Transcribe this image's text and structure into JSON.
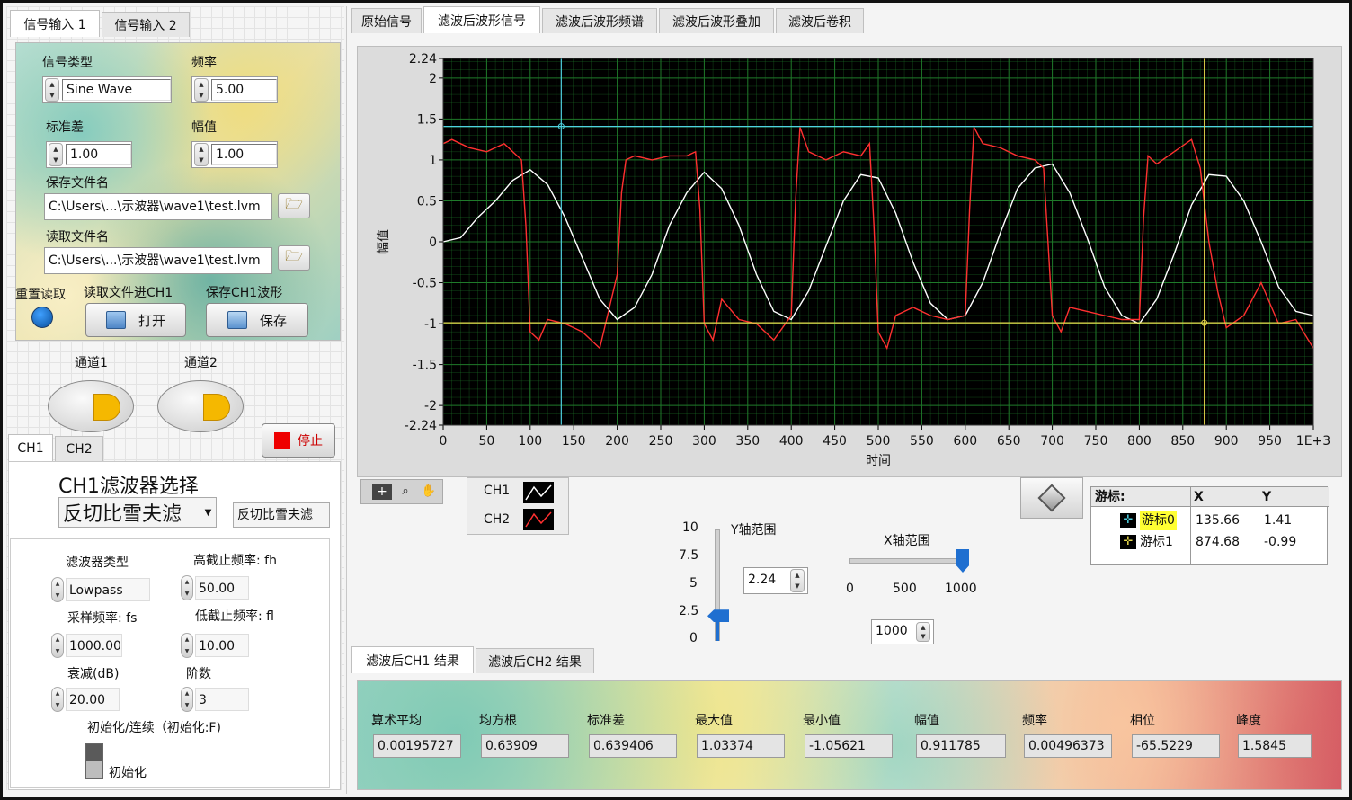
{
  "left_tabs": [
    "信号输入 1",
    "信号输入 2"
  ],
  "signal": {
    "type_label": "信号类型",
    "type_value": "Sine Wave",
    "freq_label": "频率",
    "freq_value": "5.00",
    "std_label": "标准差",
    "std_value": "1.00",
    "amp_label": "幅值",
    "amp_value": "1.00",
    "save_label": "保存文件名",
    "save_path": "C:\\Users\\...\\示波器\\wave1\\test.lvm",
    "read_label": "读取文件名",
    "read_path": "C:\\Users\\...\\示波器\\wave1\\test.lvm",
    "reset_label": "重置读取",
    "read_ch1_label": "读取文件进CH1",
    "open_label": "打开",
    "save_wave_label": "保存CH1波形",
    "save_btn_label": "保存"
  },
  "channels": {
    "ch1_label": "通道1",
    "ch2_label": "通道2",
    "stop_label": "停止"
  },
  "filter_tabs": [
    "CH1",
    "CH2"
  ],
  "filter": {
    "title": "CH1滤波器选择",
    "selected": "反切比雪夫滤",
    "selected_echo": "反切比雪夫滤",
    "type_label": "滤波器类型",
    "type_value": "Lowpass",
    "fh_label": "高截止频率: fh",
    "fh_value": "50.00",
    "fs_label": "采样频率: fs",
    "fs_value": "1000.00",
    "fl_label": "低截止频率: fl",
    "fl_value": "10.00",
    "atten_label": "衰减(dB)",
    "atten_value": "20.00",
    "order_label": "阶数",
    "order_value": "3",
    "init_label": "初始化/连续（初始化:F)",
    "init_switch_label": "初始化"
  },
  "graph_tabs": [
    "原始信号",
    "滤波后波形信号",
    "滤波后波形频谱",
    "滤波后波形叠加",
    "滤波后卷积"
  ],
  "graph_legend": [
    "CH1",
    "CH2"
  ],
  "cursor_table": {
    "headers": [
      "游标:",
      "X",
      "Y"
    ],
    "rows": [
      {
        "name": "游标0",
        "x": "135.66",
        "y": "1.41"
      },
      {
        "name": "游标1",
        "x": "874.68",
        "y": "-0.99"
      }
    ]
  },
  "y_range": {
    "label": "Y轴范围",
    "ticks": [
      "10",
      "7.5",
      "5",
      "2.5",
      "0"
    ],
    "value": "2.24",
    "slider_value": 2.24,
    "slider_max": 10
  },
  "x_range": {
    "label": "X轴范围",
    "ticks": [
      "0",
      "500",
      "1000"
    ],
    "value": "1000",
    "slider_value": 1000,
    "slider_max": 1000
  },
  "result_tabs": [
    "滤波后CH1 结果",
    "滤波后CH2 结果"
  ],
  "stats": [
    {
      "label": "算术平均",
      "value": "0.00195727"
    },
    {
      "label": "均方根",
      "value": "0.63909"
    },
    {
      "label": "标准差",
      "value": "0.639406"
    },
    {
      "label": "最大值",
      "value": "1.03374"
    },
    {
      "label": "最小值",
      "value": "-1.05621"
    },
    {
      "label": "幅值",
      "value": "0.911785"
    },
    {
      "label": "频率",
      "value": "0.00496373"
    },
    {
      "label": "相位",
      "value": "-65.5229"
    },
    {
      "label": "峰度",
      "value": "1.5845"
    }
  ],
  "chart_data": {
    "type": "line",
    "xlabel": "时间",
    "ylabel": "幅值",
    "xlim": [
      0,
      1000
    ],
    "ylim": [
      -2.24,
      2.24
    ],
    "x_ticks": [
      "0",
      "50",
      "100",
      "150",
      "200",
      "250",
      "300",
      "350",
      "400",
      "450",
      "500",
      "550",
      "600",
      "650",
      "700",
      "750",
      "800",
      "850",
      "900",
      "950",
      "1E+3"
    ],
    "y_ticks": [
      "2.24",
      "2",
      "1.5",
      "1",
      "0.5",
      "0",
      "-0.5",
      "-1",
      "-1.5",
      "-2",
      "-2.24"
    ],
    "grid": true,
    "background": "#000000",
    "grid_color": "#1f7a2a",
    "series": [
      {
        "name": "CH1",
        "color": "#ffffff",
        "x": [
          0,
          20,
          40,
          60,
          80,
          100,
          120,
          140,
          160,
          180,
          200,
          220,
          240,
          260,
          280,
          300,
          320,
          340,
          360,
          380,
          400,
          420,
          440,
          460,
          480,
          500,
          520,
          540,
          560,
          580,
          600,
          620,
          640,
          660,
          680,
          700,
          720,
          740,
          760,
          780,
          800,
          820,
          840,
          860,
          880,
          900,
          920,
          940,
          960,
          980,
          1000
        ],
        "y": [
          0.0,
          0.05,
          0.3,
          0.5,
          0.75,
          0.88,
          0.7,
          0.3,
          -0.2,
          -0.7,
          -0.95,
          -0.8,
          -0.4,
          0.2,
          0.6,
          0.85,
          0.65,
          0.2,
          -0.4,
          -0.85,
          -0.95,
          -0.6,
          -0.05,
          0.5,
          0.82,
          0.78,
          0.35,
          -0.25,
          -0.75,
          -0.95,
          -0.9,
          -0.5,
          0.1,
          0.65,
          0.9,
          0.95,
          0.6,
          0.05,
          -0.55,
          -0.9,
          -1.0,
          -0.7,
          -0.15,
          0.45,
          0.82,
          0.8,
          0.5,
          0.0,
          -0.55,
          -0.85,
          -0.9
        ]
      },
      {
        "name": "CH2",
        "color": "#ff3030",
        "x": [
          0,
          10,
          30,
          50,
          70,
          90,
          95,
          100,
          110,
          120,
          140,
          160,
          180,
          200,
          205,
          210,
          220,
          240,
          260,
          280,
          290,
          295,
          300,
          310,
          320,
          340,
          360,
          380,
          400,
          405,
          410,
          420,
          440,
          460,
          480,
          490,
          495,
          500,
          510,
          520,
          540,
          560,
          580,
          600,
          605,
          610,
          620,
          640,
          660,
          680,
          690,
          695,
          700,
          710,
          720,
          740,
          760,
          780,
          800,
          805,
          810,
          820,
          840,
          860,
          870,
          880,
          890,
          900,
          920,
          940,
          960,
          980,
          1000
        ],
        "y": [
          1.2,
          1.25,
          1.15,
          1.1,
          1.2,
          1.0,
          0.2,
          -1.1,
          -1.2,
          -0.95,
          -1.0,
          -1.1,
          -1.3,
          -0.4,
          0.6,
          1.0,
          1.05,
          1.0,
          1.05,
          1.05,
          1.1,
          0.4,
          -1.0,
          -1.2,
          -0.7,
          -0.95,
          -1.0,
          -1.2,
          -0.9,
          0.5,
          1.4,
          1.1,
          1.0,
          1.1,
          1.05,
          1.2,
          0.2,
          -1.1,
          -1.3,
          -0.9,
          -0.8,
          -0.9,
          -0.95,
          -0.9,
          0.4,
          1.4,
          1.2,
          1.15,
          1.05,
          1.0,
          0.9,
          0.0,
          -0.9,
          -1.1,
          -0.8,
          -0.85,
          -0.9,
          -0.95,
          -0.95,
          0.3,
          1.05,
          0.95,
          1.1,
          1.25,
          0.9,
          0.0,
          -0.6,
          -1.05,
          -0.9,
          -0.5,
          -1.0,
          -0.95,
          -1.3
        ]
      }
    ],
    "cursors": [
      {
        "name": "游标0",
        "x": 135.66,
        "y": 1.41,
        "color": "#4fd1e0"
      },
      {
        "name": "游标1",
        "x": 874.68,
        "y": -0.99,
        "color": "#e6d84a"
      }
    ]
  }
}
